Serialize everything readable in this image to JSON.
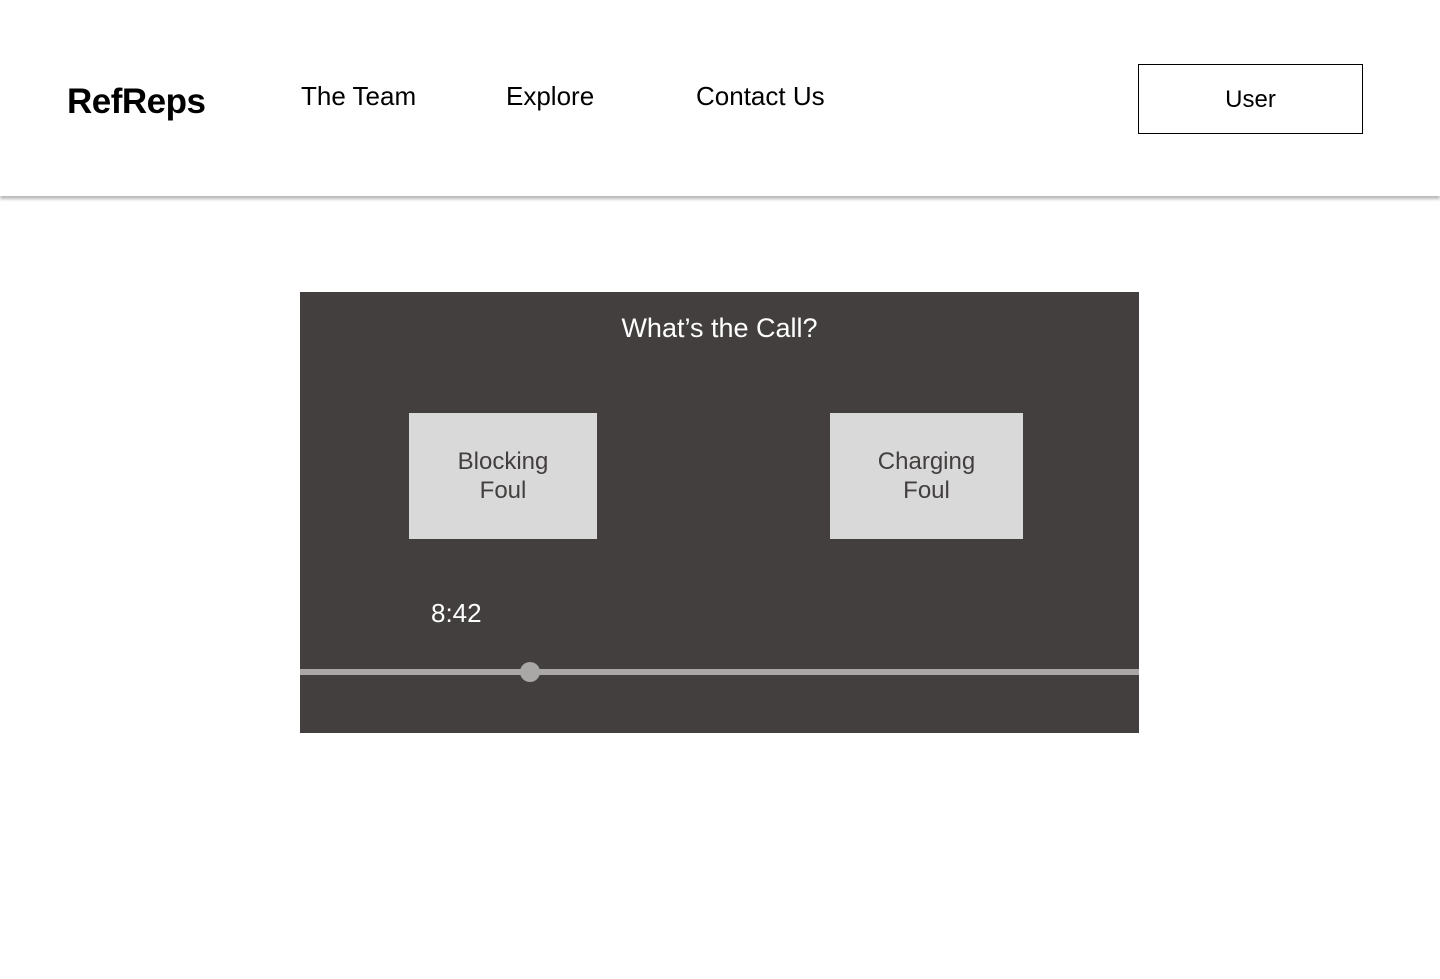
{
  "header": {
    "logo": "RefReps",
    "nav": [
      {
        "label": "The Team"
      },
      {
        "label": "Explore"
      },
      {
        "label": "Contact Us"
      }
    ],
    "user_button": "User"
  },
  "player": {
    "question": "What’s the Call?",
    "answers": [
      {
        "label": "Blocking Foul"
      },
      {
        "label": "Charging Foul"
      }
    ],
    "time": "8:42",
    "progress": 0.274
  },
  "colors": {
    "player_background": "#423f3e",
    "answer_background": "#d9d9d9",
    "scrubber": "#a9a8a7"
  }
}
